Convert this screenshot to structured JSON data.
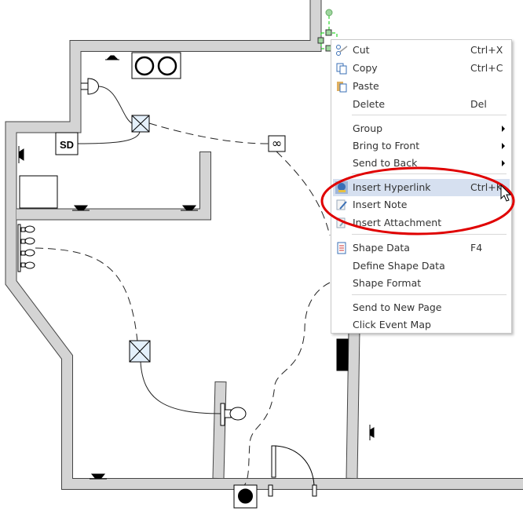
{
  "plan": {
    "smoke_detector_label": "SD"
  },
  "context_menu": {
    "items": [
      {
        "label": "Cut",
        "shortcut": "Ctrl+X",
        "icon": "scissors-icon"
      },
      {
        "label": "Copy",
        "shortcut": "Ctrl+C",
        "icon": "copy-icon"
      },
      {
        "label": "Paste",
        "shortcut": "",
        "icon": "paste-icon"
      },
      {
        "label": "Delete",
        "shortcut": "Del"
      },
      {
        "label": "Group",
        "submenu": true
      },
      {
        "label": "Bring to Front",
        "submenu": true
      },
      {
        "label": "Send to Back",
        "submenu": true
      },
      {
        "label": "Insert Hyperlink",
        "shortcut": "Ctrl+K",
        "icon": "hyperlink-icon",
        "highlighted": true
      },
      {
        "label": "Insert Note",
        "icon": "note-icon"
      },
      {
        "label": "Insert Attachment",
        "icon": "attachment-icon"
      },
      {
        "label": "Shape Data",
        "shortcut": "F4",
        "icon": "shape-data-icon"
      },
      {
        "label": "Define Shape Data"
      },
      {
        "label": "Shape Format"
      },
      {
        "label": "Send to New Page"
      },
      {
        "label": "Click Event Map"
      }
    ]
  },
  "colors": {
    "highlight": "#d6e0f0",
    "annotation": "#e00000",
    "wall": "#d4d4d4",
    "selection": "#00cc00"
  }
}
